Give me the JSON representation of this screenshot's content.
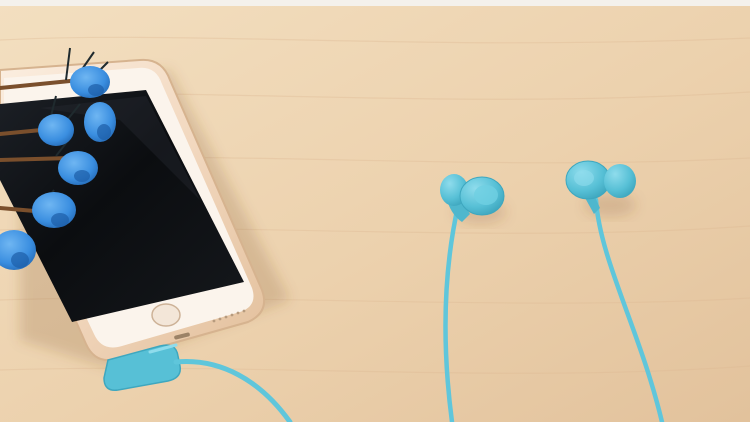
{
  "scene": {
    "description_free": true,
    "colors": {
      "table_light": "#f2dcbc",
      "table_mid": "#e8cca6",
      "table_dark": "#ddbb92",
      "wall_strip": "#f4f1ec",
      "phone_gold": "#f4dcc4",
      "phone_gold_edge": "#d9b896",
      "phone_bezel": "#fbf5ee",
      "screen_black": "#0d0f12",
      "screen_sheen": "#2a2f36",
      "cable_blue": "#5fc6db",
      "earbud_blue": "#57c0d6",
      "earbud_shade": "#3ea7bf",
      "flower_blue": "#3a8ee0",
      "flower_dark": "#1d5ea8",
      "stem_brown": "#7a4f2c",
      "shadow": "rgba(120,80,40,0.18)"
    }
  }
}
